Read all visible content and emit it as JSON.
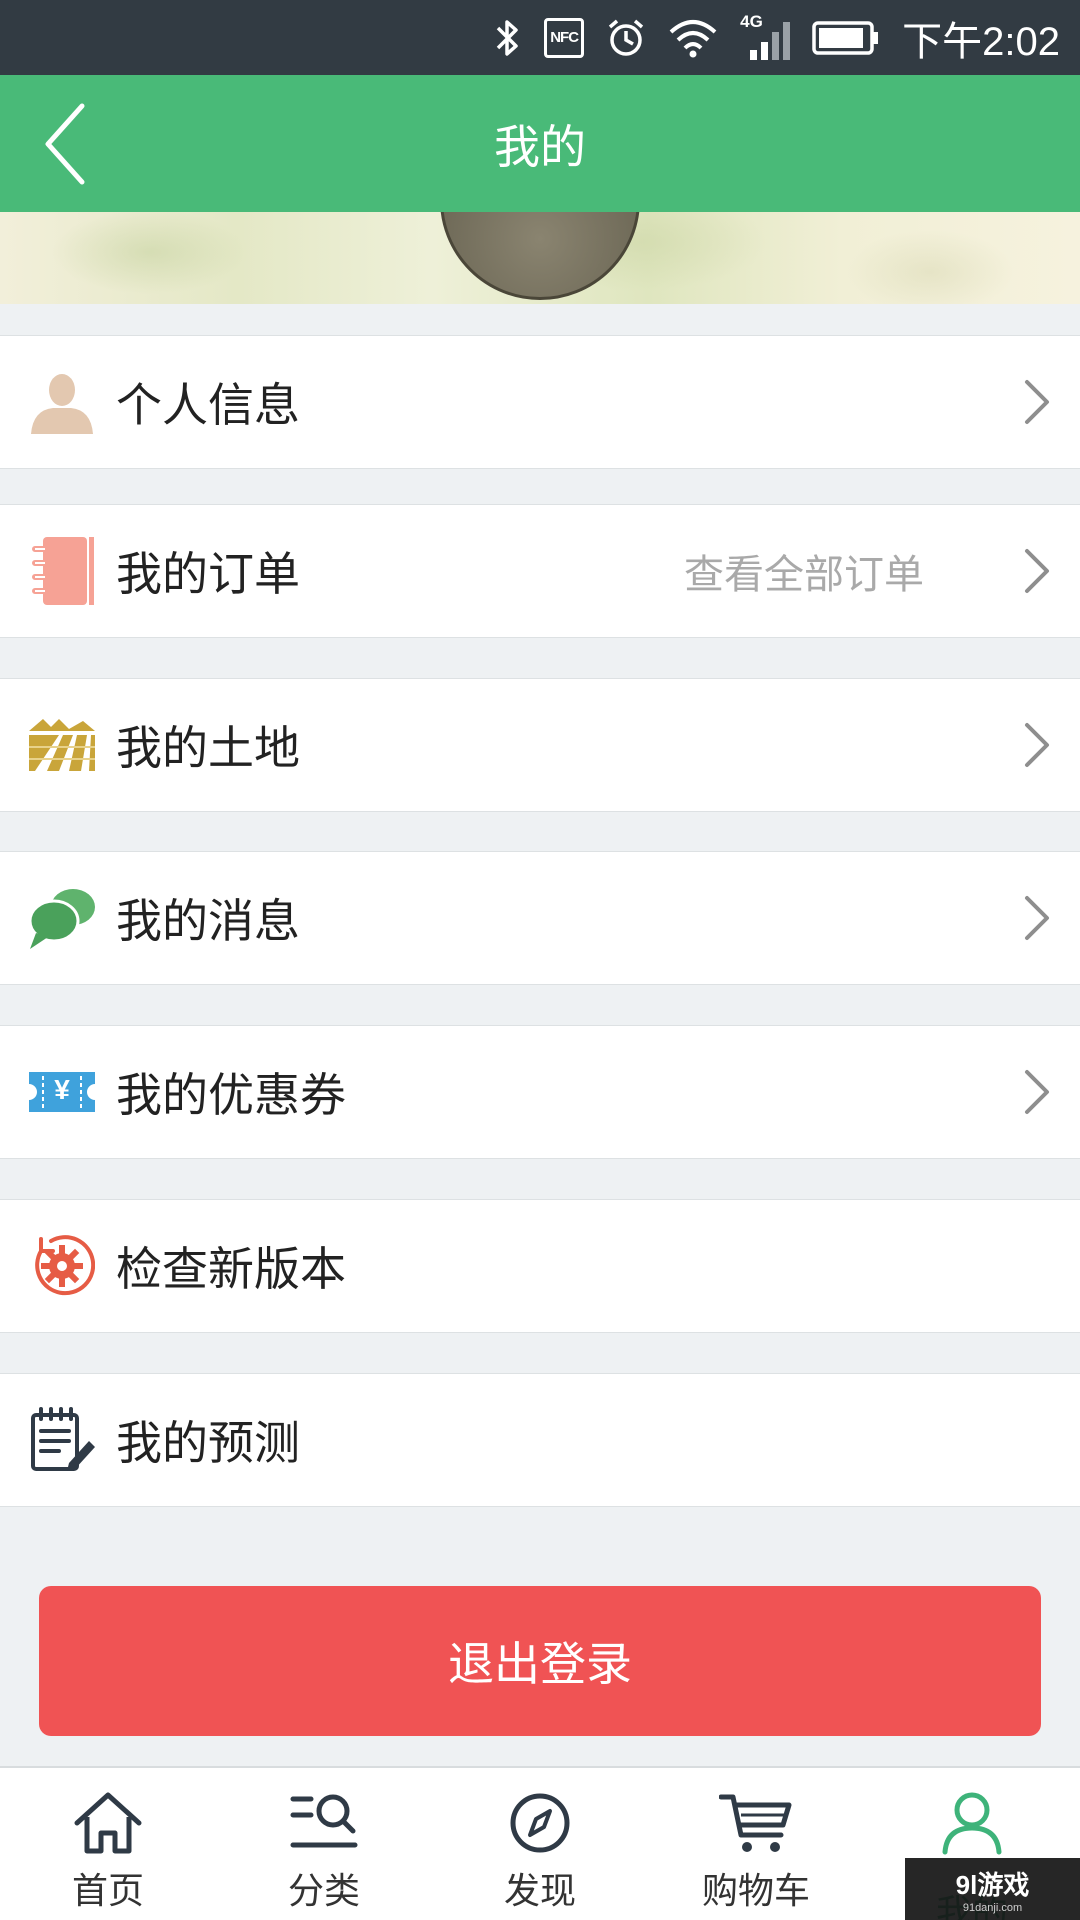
{
  "status_bar": {
    "nfc": "NFC",
    "network": "4G",
    "time": "下午2:02"
  },
  "header": {
    "title": "我的"
  },
  "menu": {
    "items": [
      {
        "label": "个人信息",
        "icon": "person-icon",
        "hint": ""
      },
      {
        "label": "我的订单",
        "icon": "order-notebook-icon",
        "hint": "查看全部订单"
      },
      {
        "label": "我的土地",
        "icon": "farmland-icon",
        "hint": ""
      },
      {
        "label": "我的消息",
        "icon": "chat-bubbles-icon",
        "hint": ""
      },
      {
        "label": "我的优惠券",
        "icon": "coupon-ticket-icon",
        "coupon_symbol": "¥",
        "hint": ""
      },
      {
        "label": "检查新版本",
        "icon": "gear-update-icon",
        "hint": ""
      },
      {
        "label": "我的预测",
        "icon": "forecast-notepad-icon",
        "hint": ""
      }
    ]
  },
  "logout": {
    "label": "退出登录"
  },
  "bottom_nav": {
    "items": [
      {
        "label": "首页",
        "icon": "home-icon",
        "active": false
      },
      {
        "label": "分类",
        "icon": "category-search-icon",
        "active": false
      },
      {
        "label": "发现",
        "icon": "compass-icon",
        "active": false
      },
      {
        "label": "购物车",
        "icon": "cart-icon",
        "active": false
      },
      {
        "label": "我的",
        "icon": "user-profile-icon",
        "active": true
      }
    ]
  },
  "watermark": {
    "main": "9l游戏",
    "sub": "91danji.com"
  },
  "colors": {
    "header_green": "#49ba78",
    "status_bar": "#323b43",
    "logout_red": "#f05354",
    "active_tab_green": "#3eb37a",
    "background": "#eef1f3"
  }
}
